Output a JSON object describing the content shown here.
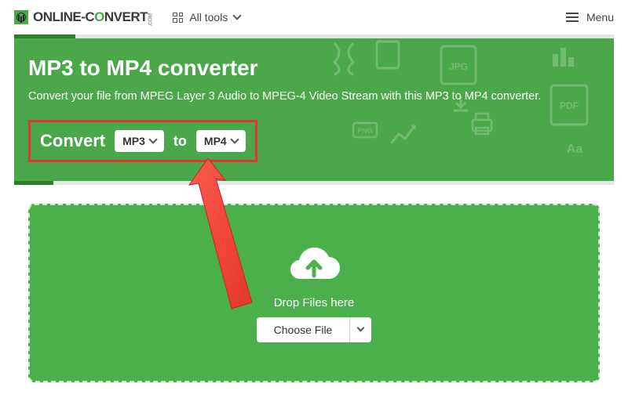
{
  "header": {
    "logo_left": "ONLINE-C",
    "logo_mid": "O",
    "logo_right": "NVERT",
    "logo_com": ".COM",
    "all_tools_label": "All tools",
    "menu_label": "Menu"
  },
  "hero": {
    "title": "MP3 to MP4 converter",
    "subtitle": "Convert your file from MPEG Layer 3 Audio to MPEG-4 Video Stream with this MP3 to MP4 converter.",
    "convert_label": "Convert",
    "from_value": "MP3",
    "to_label": "to",
    "to_value": "MP4"
  },
  "dropzone": {
    "drop_text": "Drop Files here",
    "choose_label": "Choose File"
  },
  "colors": {
    "brand_green": "#4aa84a",
    "dark_green": "#2d7f2d",
    "highlight_red": "#e3362d"
  }
}
